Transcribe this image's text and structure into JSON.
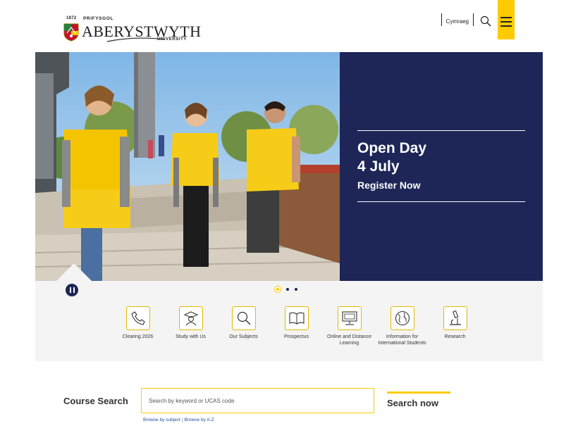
{
  "header": {
    "logo": {
      "year": "1872",
      "prifysgol": "PRIFYSGOL",
      "wordmark": "ABERYSTWYTH",
      "university": "UNIVERSITY"
    },
    "language_link": "Cymraeg",
    "search_icon": "search-icon",
    "menu_icon": "hamburger-menu-icon"
  },
  "hero": {
    "promo_title": "Open Day\n4 July",
    "promo_cta": "Register Now",
    "carousel_total": 3,
    "carousel_active": 1,
    "pause_icon": "pause-icon"
  },
  "quick_links": [
    {
      "label": "Clearing 2026",
      "icon": "phone-icon"
    },
    {
      "label": "Study with Us",
      "icon": "graduate-icon"
    },
    {
      "label": "Our Subjects",
      "icon": "magnifier-icon"
    },
    {
      "label": "Prospectus",
      "icon": "book-icon"
    },
    {
      "label": "Online and Distance Learning",
      "icon": "computer-icon"
    },
    {
      "label": "Information for International Students",
      "icon": "globe-icon"
    },
    {
      "label": "Research",
      "icon": "microscope-icon"
    }
  ],
  "course_search": {
    "label": "Course Search",
    "placeholder": "Search by keyword or UCAS code",
    "value": "",
    "button": "Search now",
    "browse_subject": "Browse by subject",
    "browse_az": "Browse by A-Z",
    "separator": "|"
  },
  "colors": {
    "navy": "#1d2657",
    "yellow": "#fecb00"
  }
}
